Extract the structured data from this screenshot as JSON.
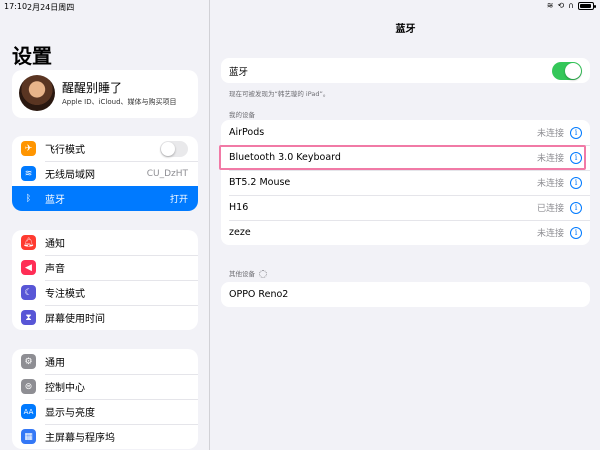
{
  "status_bar": {
    "time": "17:10",
    "date": "2月24日周四",
    "battery_level": 0.7
  },
  "sidebar": {
    "title": "设置",
    "profile": {
      "name": "醒醒别睡了",
      "subtitle": "Apple ID、iCloud、媒体与购买项目"
    },
    "group1": [
      {
        "label": "飞行模式",
        "icon": "airplane-icon",
        "color": "#ff9500",
        "value": ""
      },
      {
        "label": "无线局域网",
        "icon": "wifi-icon",
        "color": "#007aff",
        "value": "CU_DzHT"
      },
      {
        "label": "蓝牙",
        "icon": "bluetooth-icon",
        "color": "#007aff",
        "value": "打开"
      }
    ],
    "group2": [
      {
        "label": "通知",
        "icon": "bell-icon",
        "color": "#ff3b30"
      },
      {
        "label": "声音",
        "icon": "speaker-icon",
        "color": "#ff2d55"
      },
      {
        "label": "专注模式",
        "icon": "moon-icon",
        "color": "#5856d6"
      },
      {
        "label": "屏幕使用时间",
        "icon": "hourglass-icon",
        "color": "#5856d6"
      }
    ],
    "group3": [
      {
        "label": "通用",
        "icon": "gear-icon",
        "color": "#8e8e93"
      },
      {
        "label": "控制中心",
        "icon": "control-center-icon",
        "color": "#8e8e93"
      },
      {
        "label": "显示与亮度",
        "icon": "display-icon",
        "color": "#007aff",
        "glyph": "AA"
      },
      {
        "label": "主屏幕与程序坞",
        "icon": "home-screen-icon",
        "color": "#3478f6"
      }
    ]
  },
  "main": {
    "title": "蓝牙",
    "bluetooth_toggle_label": "蓝牙",
    "discoverable_note": "现在可被发现为“韩艺璇的 iPad”。",
    "my_devices_header": "我的设备",
    "my_devices": [
      {
        "name": "AirPods",
        "status": "未连接"
      },
      {
        "name": "Bluetooth 3.0 Keyboard",
        "status": "未连接"
      },
      {
        "name": "BT5.2 Mouse",
        "status": "未连接"
      },
      {
        "name": "H16",
        "status": "已连接"
      },
      {
        "name": "zeze",
        "status": "未连接"
      }
    ],
    "other_devices_header": "其他设备",
    "other_devices": [
      {
        "name": "OPPO Reno2"
      }
    ]
  },
  "colors": {
    "accent": "#007aff",
    "toggle_on": "#34c759",
    "highlight": "#f17aa6"
  }
}
